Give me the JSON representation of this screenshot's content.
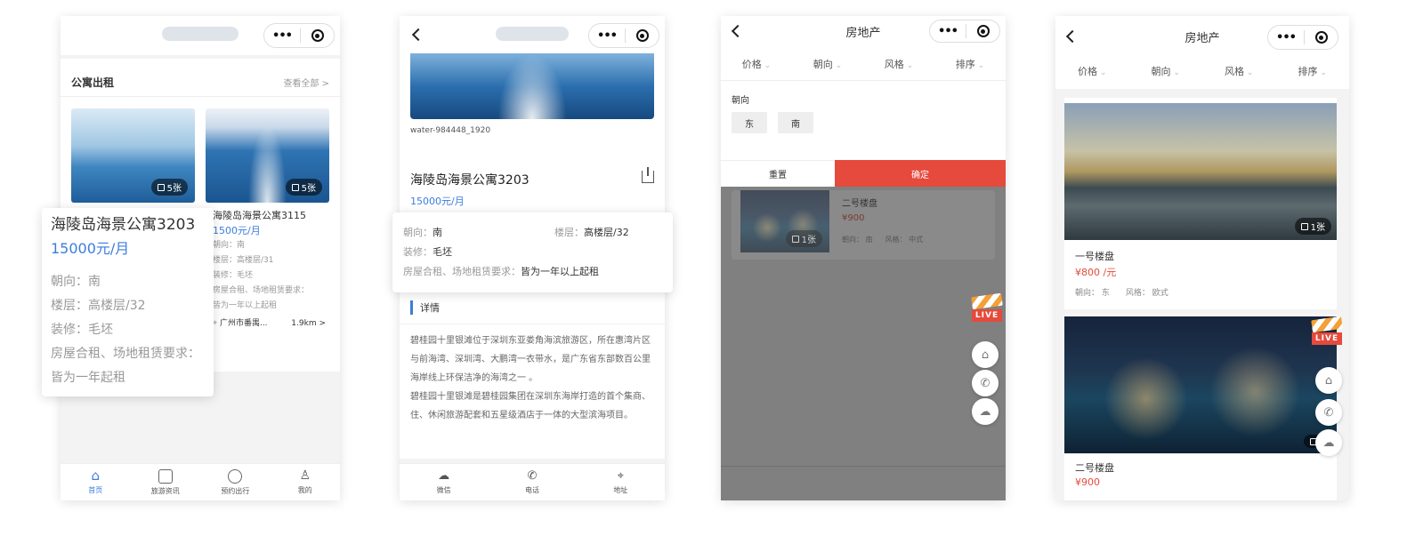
{
  "p1": {
    "section_title": "公寓出租",
    "view_all": "查看全部 >",
    "card1": {
      "badge": "5张"
    },
    "card2": {
      "badge": "5张",
      "title": "海陵岛海景公寓3115",
      "price": "1500元/月",
      "orient": "朝向：南",
      "floor": "楼层：高楼层/31",
      "deco": "装修：毛坯",
      "req1": "房屋合租、场地租赁要求：",
      "req2": "皆为一年以上起租",
      "location": "广州市番禺...",
      "dist": "1.9km >"
    },
    "popup": {
      "title": "海陵岛海景公寓3203",
      "price": "15000元/月",
      "orient": "朝向：南",
      "floor": "楼层：高楼层/32",
      "deco": "装修：毛坯",
      "req1": "房屋合租、场地租赁要求：",
      "req2": "皆为一年起租"
    },
    "tabs": [
      {
        "label": "首页",
        "icon": "home-icon"
      },
      {
        "label": "旅游资讯",
        "icon": "article-icon"
      },
      {
        "label": "预约出行",
        "icon": "clock-icon"
      },
      {
        "label": "我的",
        "icon": "user-icon"
      }
    ]
  },
  "p2": {
    "image_caption": "water-984448_1920",
    "title": "海陵岛海景公寓3203",
    "price": "15000元/月",
    "popup": {
      "orient_label": "朝向：",
      "orient_value": "南",
      "floor_label": "楼层：",
      "floor_value": "高楼层/32",
      "deco_label": "装修：",
      "deco_value": "毛坯",
      "req_label": "房屋合租、场地租赁要求：",
      "req_value": "皆为一年以上起租"
    },
    "detail_heading": "详情",
    "desc1": "碧桂园十里银滩位于深圳东亚娄角海滨旅游区，所在惠湾片区与前海湾、深圳湾、大鹏湾一衣带水，是广东省东部数百公里海岸线上环保洁净的海湾之一  。",
    "desc2": "碧桂园十里银滩是碧桂园集团在深圳东海岸打造的首个集商、住、休闲旅游配套和五星级酒店于一体的大型滨海项目。",
    "actions": [
      {
        "label": "微信",
        "icon": "wechat-icon"
      },
      {
        "label": "电话",
        "icon": "phone-icon"
      },
      {
        "label": "地址",
        "icon": "location-icon"
      }
    ]
  },
  "p3": {
    "title": "房地产",
    "filters": [
      "价格",
      "朝向",
      "风格",
      "排序"
    ],
    "orient_heading": "朝向",
    "options": [
      "东",
      "南"
    ],
    "reset": "重置",
    "confirm": "确定",
    "item": {
      "name": "二号楼盘",
      "price": "¥900",
      "orient": "朝向：  南",
      "style": "风格：  中式",
      "badge": "1张"
    },
    "live": "LIVE"
  },
  "p4": {
    "title": "房地产",
    "filters": [
      "价格",
      "朝向",
      "风格",
      "排序"
    ],
    "item1": {
      "badge": "1张",
      "name": "一号楼盘",
      "price": "¥800 /元",
      "orient": "朝向：  东",
      "style": "风格：  欧式"
    },
    "item2": {
      "name": "二号楼盘",
      "price": "¥900",
      "badge": "1"
    },
    "live": "LIVE"
  },
  "colors": {
    "accent": "#3b7ddd",
    "confirm": "#e54a3c",
    "overlay": "#808080"
  }
}
